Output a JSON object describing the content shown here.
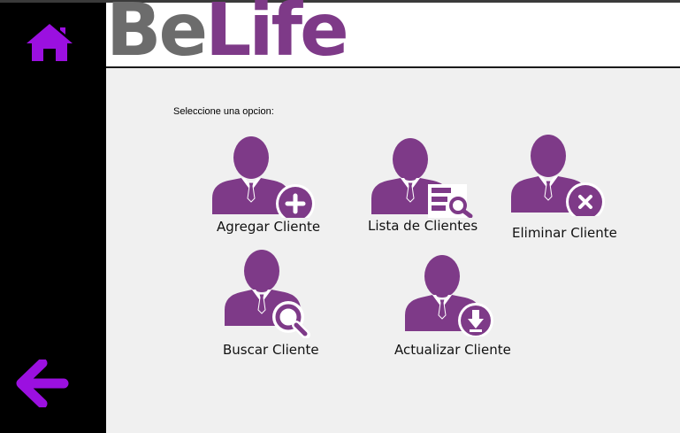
{
  "header": {
    "logo_part1": "Be",
    "logo_part2": "Life",
    "logo_color_gray": "#6c6c6c",
    "logo_color_purple": "#7e3a88"
  },
  "sidebar": {
    "home_icon": "home-icon",
    "back_icon": "arrow-left-icon",
    "icon_color": "#9b10e0"
  },
  "main": {
    "prompt": "Seleccione una opcion:",
    "tiles": [
      {
        "label": "Agregar Cliente",
        "icon": "user-add-icon"
      },
      {
        "label": "Lista de Clientes",
        "icon": "user-list-icon"
      },
      {
        "label": "Eliminar Cliente",
        "icon": "user-delete-icon"
      },
      {
        "label": "Buscar Cliente",
        "icon": "user-search-icon"
      },
      {
        "label": "Actualizar Cliente",
        "icon": "user-update-icon"
      }
    ],
    "icon_color": "#7e3a88"
  }
}
